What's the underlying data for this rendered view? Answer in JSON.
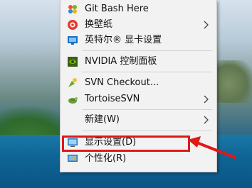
{
  "context_menu": {
    "items": [
      {
        "label": "Git Bash Here",
        "icon": "git-bash-icon",
        "submenu": false
      },
      {
        "label": "换壁纸",
        "icon": "wallpaper-icon",
        "submenu": true
      },
      {
        "label": "英特尔® 显卡设置",
        "icon": "intel-graphics-icon",
        "submenu": false
      },
      {
        "label": "NVIDIA 控制面板",
        "icon": "nvidia-icon",
        "submenu": false
      },
      {
        "label": "SVN Checkout...",
        "icon": "svn-checkout-icon",
        "submenu": false
      },
      {
        "label": "TortoiseSVN",
        "icon": "tortoisesvn-icon",
        "submenu": true
      },
      {
        "label": "新建(W)",
        "icon": "",
        "submenu": true
      },
      {
        "label": "显示设置(D)",
        "icon": "display-settings-icon",
        "submenu": false,
        "highlighted": true
      },
      {
        "label": "个性化(R)",
        "icon": "personalize-icon",
        "submenu": false
      }
    ]
  },
  "annotation": {
    "highlight_color": "#e01818",
    "arrow_color": "#e01818"
  },
  "colors": {
    "menu_background": "#f2f2f2",
    "menu_text": "#111111"
  }
}
